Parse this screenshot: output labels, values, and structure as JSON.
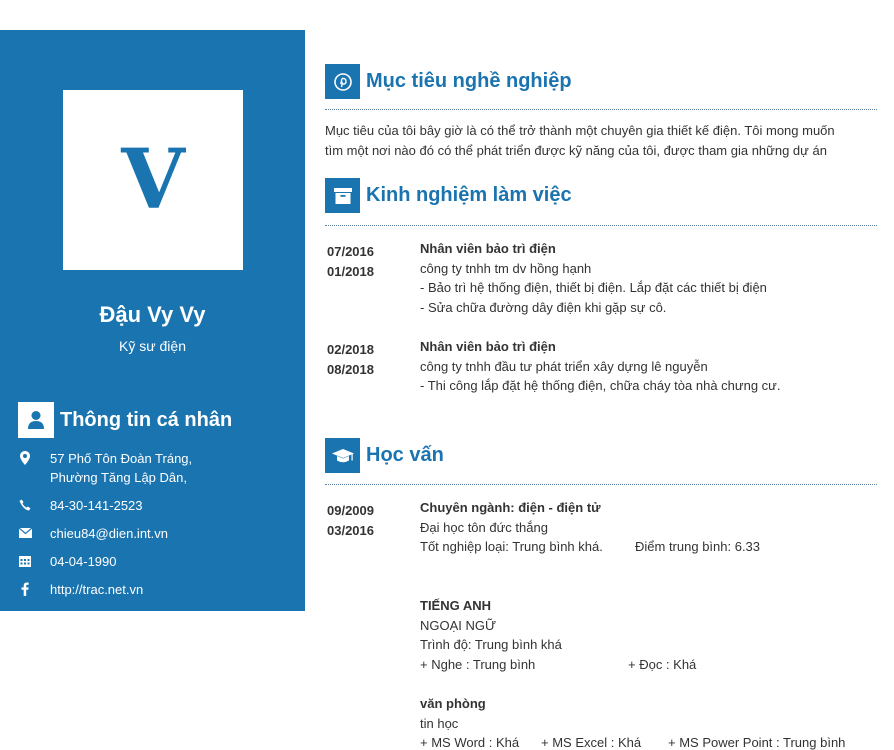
{
  "profile": {
    "initial": "V",
    "name": "Đậu Vy Vy",
    "role": "Kỹ sư điện"
  },
  "personal": {
    "title": "Thông tin cá nhân",
    "address_line1": "57 Phố Tôn Đoàn Tráng,",
    "address_line2": "Phường Tăng Lập Dân,",
    "phone": "84-30-141-2523",
    "email": "chieu84@dien.int.vn",
    "birthday": "04-04-1990",
    "website": "http://trac.net.vn"
  },
  "objective": {
    "title": "Mục tiêu nghề nghiệp",
    "line1": "Mục tiêu của tôi bây giờ là có thể trở thành một chuyên gia thiết kế điện. Tôi mong muốn",
    "line2": "tìm một nơi nào đó có thể phát triển được kỹ năng của tôi, được tham gia những dự án"
  },
  "experience": {
    "title": "Kinh nghiệm làm việc",
    "items": [
      {
        "start": "07/2016",
        "end": "01/2018",
        "position": "Nhân viên bảo trì điện",
        "company": "công ty  tnhh tm dv hồng hạnh",
        "desc1": "- Bảo trì hệ thống điện, thiết bị điện. Lắp đặt các thiết bị điện",
        "desc2": "- Sửa chữa đường dây điện khi gặp sự cô."
      },
      {
        "start": "02/2018",
        "end": "08/2018",
        "position": "Nhân viên bảo trì điện",
        "company": "công ty  tnhh đầu tư phát triển xây dựng lê nguyễn",
        "desc1": "- Thi công lắp đặt hệ thống điện, chữa cháy tòa nhà chưng cư."
      }
    ]
  },
  "education": {
    "title": "Học vấn",
    "start": "09/2009",
    "end": "03/2016",
    "major": "Chuyên ngành: điện - điện tử",
    "school": "Đại học tôn đức thắng",
    "graduation": "Tốt nghiệp loại: Trung bình khá.",
    "gpa": "Điểm trung bình:  6.33",
    "english": {
      "heading": "TIẾNG ANH",
      "sub": "NGOẠI NGỮ",
      "level": "Trình độ: Trung bình khá",
      "listening": "+ Nghe : Trung bình",
      "reading": "+ Đọc : Khá"
    },
    "office": {
      "heading": "văn phòng",
      "sub": "tin học",
      "word": "+ MS Word : Khá",
      "excel": "+ MS Excel : Khá",
      "ppt": "+ MS Power Point : Trung bình"
    }
  },
  "colors": {
    "accent": "#1a74b0"
  }
}
